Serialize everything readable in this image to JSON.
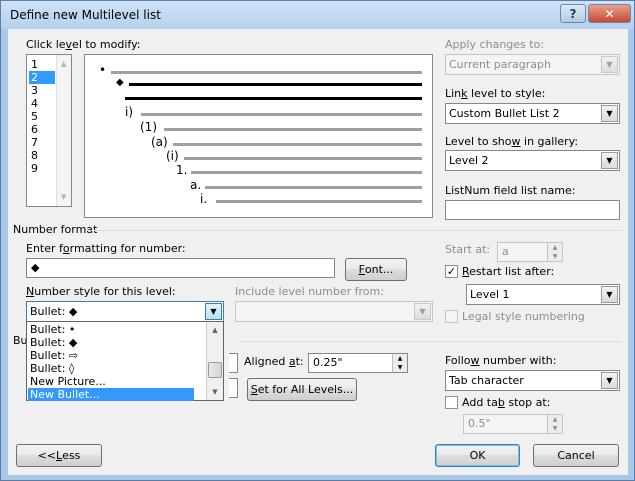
{
  "window": {
    "title": "Define new Multilevel list",
    "help_glyph": "?",
    "close_glyph": "✕"
  },
  "levels": {
    "label_pre": "Click le",
    "label_u": "v",
    "label_post": "el to modify:",
    "items": [
      "1",
      "2",
      "3",
      "4",
      "5",
      "6",
      "7",
      "8",
      "9"
    ],
    "selected": "2"
  },
  "preview": {
    "level1_marker": "•",
    "level2_marker": "◆",
    "markers": [
      "i)",
      "(1)",
      "(a)",
      "(i)",
      "1.",
      "a.",
      "i."
    ]
  },
  "apply": {
    "label": "Apply changes to:",
    "value": "Current paragraph"
  },
  "link_level": {
    "label_pre": "Lin",
    "label_u": "k",
    "label_post": " level to style:",
    "value": "Custom Bullet List 2"
  },
  "gallery_level": {
    "label_pre": "Level to sho",
    "label_u": "w",
    "label_post": " in gallery:",
    "value": "Level 2"
  },
  "listnum": {
    "label": "ListNum field list name:",
    "value": ""
  },
  "number_format": {
    "section_label": "Number format",
    "enter_label_pre": "Enter f",
    "enter_label_u": "o",
    "enter_label_post": "rmatting for number:",
    "value": "◆",
    "font_button_u": "F",
    "font_button_post": "ont...",
    "style_label_pre": "",
    "style_label_u": "N",
    "style_label_post": "umber style for this level:",
    "style_value": "Bullet:  ◆",
    "include_label": "Include level number from:",
    "include_value": ""
  },
  "start_at": {
    "label": "Start at:",
    "value": "a"
  },
  "restart": {
    "checked": true,
    "label_pre": "",
    "label_u": "R",
    "label_post": "estart list after:",
    "value": "Level 1"
  },
  "legal": {
    "checked": false,
    "label": "Legal style numbering"
  },
  "position": {
    "section_label_visible": "Bu",
    "aligned_label_pre": "Aligned ",
    "aligned_label_u": "a",
    "aligned_label_post": "t:",
    "aligned_value": "0.25\"",
    "set_all_pre": "",
    "set_all_u": "S",
    "set_all_post": "et for All Levels..."
  },
  "follow": {
    "label_pre": "Follo",
    "label_u": "w",
    "label_post": " number with:",
    "value": "Tab character"
  },
  "add_tab": {
    "checked": false,
    "label_pre": "Add ta",
    "label_u": "b",
    "label_post": " stop at:",
    "value": "0.5\""
  },
  "dropdown": {
    "items": [
      "Bullet:  •",
      "Bullet:  ◆",
      "Bullet:  ⇨",
      "Bullet:  ◊",
      "New Picture...",
      "New Bullet..."
    ],
    "selected_index": 5
  },
  "buttons": {
    "less_pre": "<< ",
    "less_u": "L",
    "less_post": "ess",
    "ok": "OK",
    "cancel": "Cancel"
  }
}
